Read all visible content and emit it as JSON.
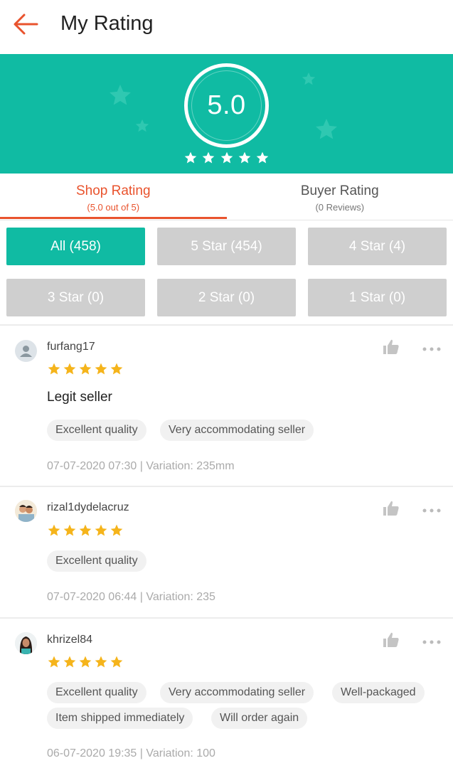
{
  "header": {
    "title": "My Rating",
    "back_icon": "arrow-left-icon"
  },
  "summary": {
    "score": "5.0",
    "stars": 5,
    "colors": {
      "teal": "#10bba3",
      "accent": "#e9532d",
      "star": "#f5b41b"
    }
  },
  "tabs": [
    {
      "label": "Shop Rating",
      "sub": "(5.0 out of 5)",
      "active": true
    },
    {
      "label": "Buyer Rating",
      "sub": "(0 Reviews)",
      "active": false
    }
  ],
  "filters": [
    {
      "label": "All (458)",
      "active": true
    },
    {
      "label": "5 Star (454)",
      "active": false
    },
    {
      "label": "4 Star (4)",
      "active": false
    },
    {
      "label": "3 Star (0)",
      "active": false
    },
    {
      "label": "2 Star (0)",
      "active": false
    },
    {
      "label": "1 Star (0)",
      "active": false
    }
  ],
  "reviews": [
    {
      "username": "furfang17",
      "rating": 5,
      "comment": "Legit seller",
      "tags": [
        "Excellent quality",
        "Very accommodating seller"
      ],
      "meta": "07-07-2020 07:30 | Variation: 235mm"
    },
    {
      "username": "rizal1dydelacruz",
      "rating": 5,
      "comment": "",
      "tags": [
        "Excellent quality"
      ],
      "meta": "07-07-2020 06:44 | Variation: 235"
    },
    {
      "username": "khrizel84",
      "rating": 5,
      "comment": "",
      "tags": [
        "Excellent quality",
        "Very accommodating seller",
        "Well-packaged",
        "Item shipped immediately",
        "Will order again"
      ],
      "meta": "06-07-2020 19:35 | Variation: 100"
    }
  ]
}
